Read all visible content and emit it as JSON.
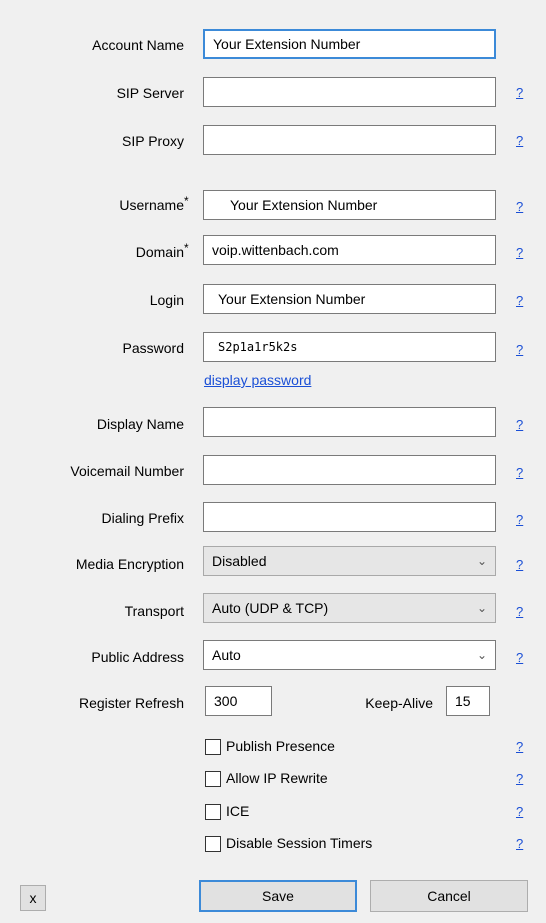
{
  "labels": {
    "account_name": "Account Name",
    "sip_server": "SIP Server",
    "sip_proxy": "SIP Proxy",
    "username": "Username",
    "domain": "Domain",
    "login": "Login",
    "password": "Password",
    "display_name": "Display Name",
    "voicemail_number": "Voicemail Number",
    "dialing_prefix": "Dialing Prefix",
    "media_encryption": "Media Encryption",
    "transport": "Transport",
    "public_address": "Public Address",
    "register_refresh": "Register Refresh",
    "keep_alive": "Keep-Alive",
    "required_mark": "*"
  },
  "values": {
    "account_name": "Your Extension Number",
    "sip_server": "",
    "sip_proxy": "",
    "username": "Your Extension Number",
    "domain": "voip.wittenbach.com",
    "login": "Your Extension Number",
    "password": "S2p1a1r5k2s",
    "display_name": "",
    "voicemail_number": "",
    "dialing_prefix": "",
    "media_encryption": "Disabled",
    "transport": "Auto (UDP & TCP)",
    "public_address": "Auto",
    "register_refresh": "300",
    "keep_alive": "15"
  },
  "links": {
    "display_password": "display password",
    "help": "?"
  },
  "checkboxes": {
    "publish_presence": "Publish Presence",
    "allow_ip_rewrite": "Allow IP Rewrite",
    "ice": "ICE",
    "disable_session_timers": "Disable Session Timers"
  },
  "buttons": {
    "close": "x",
    "save": "Save",
    "cancel": "Cancel"
  },
  "icons": {
    "chevron": "chevron-down-icon"
  }
}
